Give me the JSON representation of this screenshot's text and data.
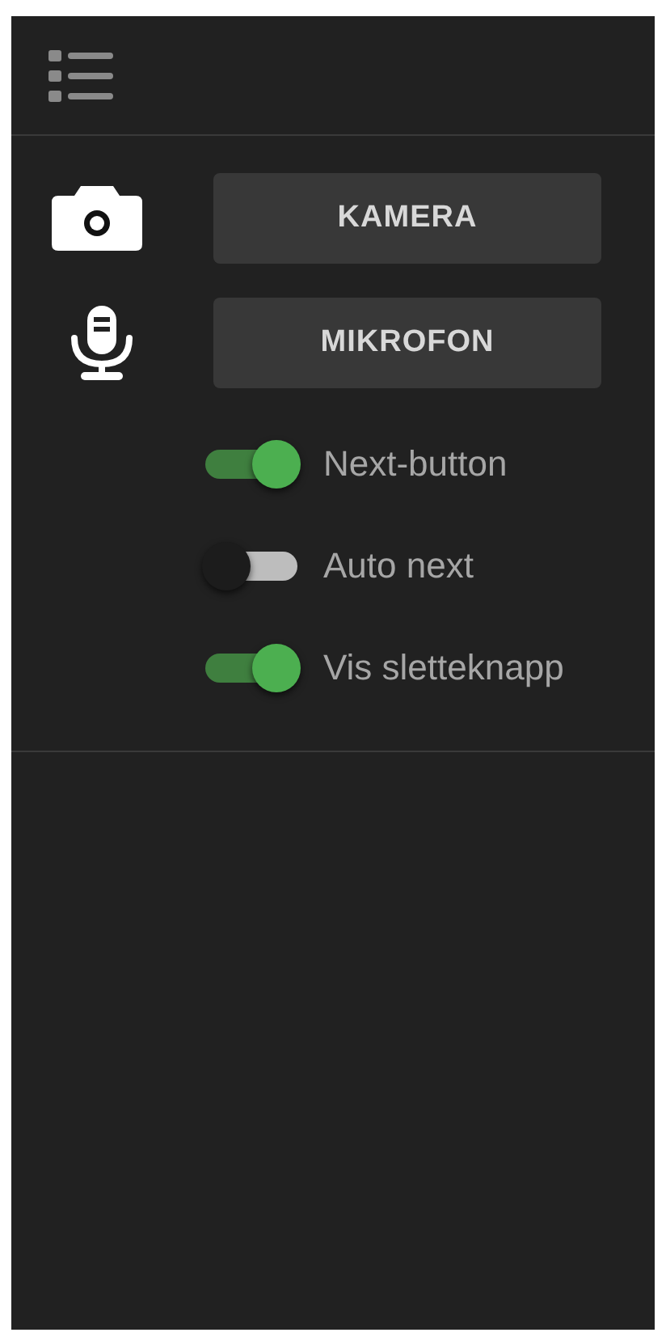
{
  "devices": [
    {
      "kind": "camera",
      "label": "KAMERA"
    },
    {
      "kind": "microphone",
      "label": "MIKROFON"
    }
  ],
  "toggles": [
    {
      "label": "Next-button",
      "on": true
    },
    {
      "label": "Auto next",
      "on": false
    },
    {
      "label": "Vis sletteknapp",
      "on": true
    }
  ]
}
